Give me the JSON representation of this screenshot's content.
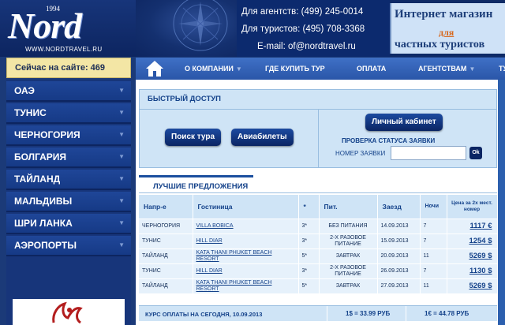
{
  "header": {
    "logo_year": "1994",
    "logo_word": "Nord",
    "logo_url": "WWW.NORDTRAVEL.RU",
    "contacts": [
      "Для агентств:  (499) 245-0014",
      "Для туристов:  (495) 708-3368",
      "E-mail:  of@nordtravel.ru"
    ],
    "promo": {
      "line1": "Интернет магазин",
      "line2": "для",
      "line3": "частных туристов"
    }
  },
  "online_counter": "Сейчас на сайте: 469",
  "nav": {
    "home_icon": "home-icon",
    "items": [
      "О КОМПАНИИ",
      "ГДЕ КУПИТЬ ТУР",
      "ОПЛАТА",
      "АГЕНТСТВАМ",
      "ТУ"
    ]
  },
  "sidebar": {
    "items": [
      "ОАЭ",
      "ТУНИС",
      "ЧЕРНОГОРИЯ",
      "БОЛГАРИЯ",
      "ТАЙЛАНД",
      "МАЛЬДИВЫ",
      "ШРИ ЛАНКА",
      "АЭРОПОРТЫ"
    ]
  },
  "quick_access": {
    "title": "БЫСТРЫЙ ДОСТУП",
    "search_tour_label": "Поиск тура",
    "flights_label": "Авиабилеты",
    "cabinet_label": "Личный кабинет",
    "status_title": "ПРОВЕРКА СТАТУСА ЗАЯВКИ",
    "request_label": "НОМЕР ЗАЯВКИ",
    "request_value": "",
    "ok_label": "Ok"
  },
  "offers": {
    "title": "ЛУЧШИЕ ПРЕДЛОЖЕНИЯ",
    "columns": [
      "Напр-е",
      "Гостиница",
      "*",
      "Пит.",
      "Заезд",
      "Ночи",
      "Цена за 2х мест. номер"
    ],
    "rows": [
      {
        "dir": "ЧЕРНОГОРИЯ",
        "hotel": "VILLA BOBICA",
        "stars": "3*",
        "food": "БЕЗ ПИТАНИЯ",
        "date": "14.09.2013",
        "nights": "7",
        "price": "1117 €"
      },
      {
        "dir": "ТУНИС",
        "hotel": "HILL DIAR",
        "stars": "3*",
        "food": "2-Х РАЗОВОЕ ПИТАНИЕ",
        "date": "15.09.2013",
        "nights": "7",
        "price": "1254 $"
      },
      {
        "dir": "ТАЙЛАНД",
        "hotel": "KATA THANI PHUKET BEACH RESORT",
        "stars": "5*",
        "food": "ЗАВТРАК",
        "date": "20.09.2013",
        "nights": "11",
        "price": "5269 $"
      },
      {
        "dir": "ТУНИС",
        "hotel": "HILL DIAR",
        "stars": "3*",
        "food": "2-Х РАЗОВОЕ ПИТАНИЕ",
        "date": "26.09.2013",
        "nights": "7",
        "price": "1130 $"
      },
      {
        "dir": "ТАЙЛАНД",
        "hotel": "KATA THANI PHUKET BEACH RESORT",
        "stars": "5*",
        "food": "ЗАВТРАК",
        "date": "27.09.2013",
        "nights": "11",
        "price": "5269 $"
      }
    ]
  },
  "rates": {
    "label": "КУРС ОПЛАТЫ НА СЕГОДНЯ, 10.09.2013",
    "usd": "1$ = 33.99 РУБ",
    "eur": "1€ = 44.78 РУБ"
  },
  "colors": {
    "nav_blue": "#2a56a8",
    "dark_blue": "#0e2a66",
    "panel_light": "#cfe4f6",
    "counter_yellow": "#f3e6a5",
    "promo_orange": "#d7671b"
  }
}
